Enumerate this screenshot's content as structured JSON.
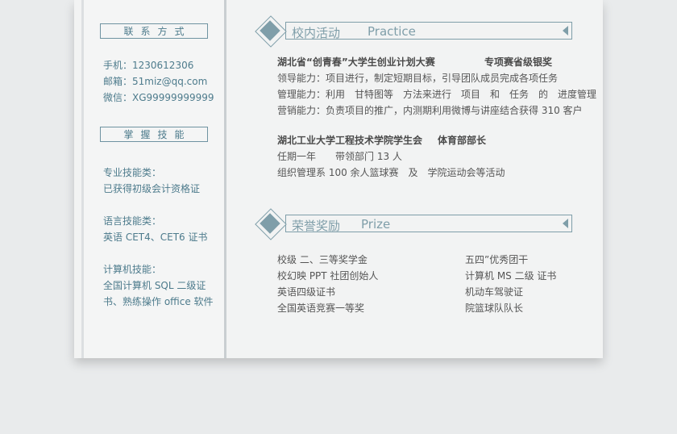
{
  "sidebar": {
    "contact_title": "联系方式",
    "phone": "手机：1230612306",
    "email": "邮箱：51miz@qq.com",
    "wechat": "微信：XG99999999999",
    "skills_title": "掌握技能",
    "pro_label": "专业技能类：",
    "pro_value": "已获得初级会计资格证",
    "lang_label": "语言技能类：",
    "lang_value": "英语 CET4、CET6 证书",
    "comp_label": "计算机技能：",
    "comp_value1": "全国计算机 SQL 二级证",
    "comp_value2": "书、熟练操作 office 软件"
  },
  "practice": {
    "title_cn": "校内活动",
    "title_en": "Practice",
    "item1_title": "湖北省“创青春”大学生创业计划大赛",
    "item1_award": "专项赛省级银奖",
    "item1_line1": "领导能力：项目进行，制定短期目标，引导团队成员完成各项任务",
    "item1_line2": "管理能力：利用　甘特图等　方法来进行　项目　和　任务　的　进度管理",
    "item1_line3": "营销能力：负责项目的推广，内测期利用微博与讲座结合获得 310 客户",
    "item2_title": "湖北工业大学工程技术学院学生会",
    "item2_role": "体育部部长",
    "item2_line1": "任期一年　　带领部门 13 人",
    "item2_line2": "组织管理系 100 余人篮球赛　及　学院运动会等活动"
  },
  "prize": {
    "title_cn": "荣誉奖励",
    "title_en": "Prize",
    "left": [
      "校级  二、三等奖学金",
      "校幻映 PPT 社团创始人",
      "英语四级证书",
      "全国英语竞赛一等奖"
    ],
    "right": [
      "五四”优秀团干",
      "计算机 MS 二级  证书",
      "机动车驾驶证",
      "院篮球队队长"
    ]
  }
}
